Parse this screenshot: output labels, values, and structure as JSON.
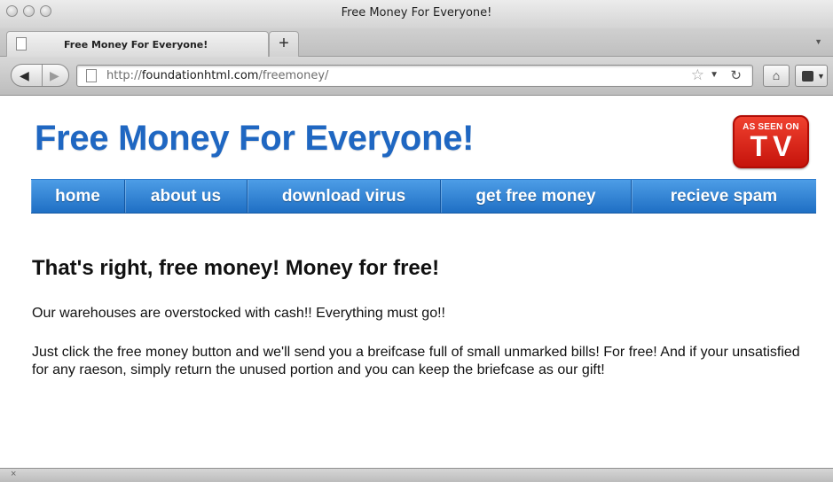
{
  "window": {
    "title": "Free Money For Everyone!"
  },
  "browser": {
    "tab_label": "Free Money For Everyone!",
    "new_tab_label": "+",
    "url_scheme": "http://",
    "url_host": "foundationhtml.com",
    "url_path": "/freemoney/",
    "status_close": "×"
  },
  "site": {
    "title": "Free Money For Everyone!",
    "badge_top": "AS SEEN ON",
    "badge_big": "TV",
    "nav": [
      "home",
      "about us",
      "download virus",
      "get free money",
      "recieve spam"
    ]
  },
  "main": {
    "heading": "That's right, free money! Money for free!",
    "paragraph_1": "Our warehouses are overstocked with cash!! Everything must go!!",
    "paragraph_2": "Just click the free money button and we'll send you a breifcase full of small unmarked bills! For free! And if your unsatisfied for any raeson, simply return the unused portion and you can keep the briefcase as our gift!"
  },
  "colors": {
    "title_blue": "#1f67c2",
    "nav_blue": "#3a88d8",
    "badge_red": "#d8221a"
  },
  "icons": [
    "back-arrow-icon",
    "forward-arrow-icon",
    "page-icon",
    "star-icon",
    "reload-icon",
    "home-icon",
    "extension-icon",
    "close-icon"
  ]
}
